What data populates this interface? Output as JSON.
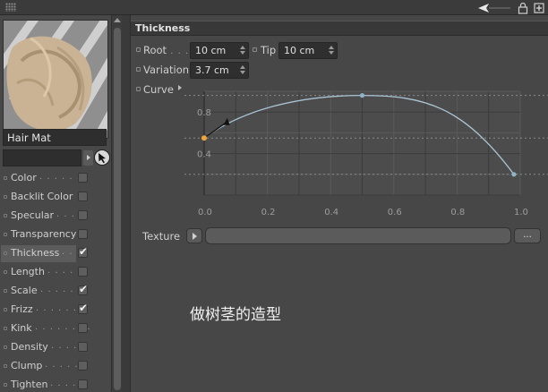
{
  "topbar": {
    "icons": [
      "grip-icon",
      "arrow-left-icon",
      "lock-icon",
      "new-window-icon"
    ]
  },
  "material": {
    "name": "Hair Mat",
    "preview_icon": "hair-preview-thumbnail"
  },
  "channels": [
    {
      "label": "Color",
      "checked": false,
      "active": false
    },
    {
      "label": "Backlit Color",
      "checked": false,
      "active": false
    },
    {
      "label": "Specular",
      "checked": false,
      "active": false
    },
    {
      "label": "Transparency",
      "checked": false,
      "active": false
    },
    {
      "label": "Thickness",
      "checked": true,
      "active": true
    },
    {
      "label": "Length",
      "checked": false,
      "active": false
    },
    {
      "label": "Scale",
      "checked": true,
      "active": false
    },
    {
      "label": "Frizz",
      "checked": true,
      "active": false
    },
    {
      "label": "Kink",
      "checked": false,
      "active": false
    },
    {
      "label": "Density",
      "checked": false,
      "active": false
    },
    {
      "label": "Clump",
      "checked": false,
      "active": false
    },
    {
      "label": "Tighten",
      "checked": false,
      "active": false
    }
  ],
  "section": {
    "title": "Thickness"
  },
  "params": {
    "root_label": "Root",
    "root_value": "10 cm",
    "tip_label": "Tip",
    "tip_value": "10 cm",
    "variation_label": "Variation",
    "variation_value": "3.7 cm",
    "curve_label": "Curve"
  },
  "curve": {
    "x_ticks": [
      "0.0",
      "0.2",
      "0.4",
      "0.6",
      "0.8",
      "1.0"
    ],
    "y_ticks": [
      "0.8",
      "0.4"
    ],
    "points": [
      [
        0.0,
        0.55
      ],
      [
        0.5,
        0.96
      ],
      [
        0.98,
        0.2
      ]
    ],
    "colors": {
      "line": "#a9c4d4",
      "start_point": "#f0a53a",
      "point": "#8fb4c6",
      "grid_light": "#5a5a5a",
      "grid_dark": "#3c3c3c",
      "plot_bg": "#4c4c4c"
    }
  },
  "texture": {
    "label": "Texture",
    "more_label": "..."
  },
  "caption": "做树茎的造型"
}
